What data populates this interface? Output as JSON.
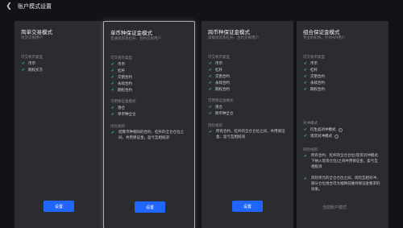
{
  "header": {
    "title": "账户模式设置"
  },
  "cards": [
    {
      "title": "简单交易模式",
      "subtitle": "现货交易用户",
      "tradable_label": "可交易币类型",
      "tradable": [
        "币币",
        "期权买方"
      ],
      "button": "设置"
    },
    {
      "title": "单币种保证金模式",
      "subtitle": "普通现货及杠杆、合约交易用户",
      "tradable_label": "可交易币类型",
      "tradable": [
        "币币",
        "杠杆",
        "交割合约",
        "永续合约",
        "期权合约"
      ],
      "margin_label": "可用保证金模式",
      "margin": [
        "逐仓",
        "单币种全仓"
      ],
      "risk_label": "风险规则",
      "risk_text": "结算币种相同的合约、杠杆的全仓仓位之间，共用保证金，盈亏互相抵消",
      "button": "设置"
    },
    {
      "title": "跨币种保证金模式",
      "subtitle": "高级现货及杠杆、合约交易用户",
      "tradable_label": "可交易币类型",
      "tradable": [
        "币币",
        "杠杆",
        "交割合约",
        "永续合约",
        "期权合约"
      ],
      "margin_label": "可用保证金模式",
      "margin": [
        "逐仓",
        "跨币种全仓"
      ],
      "risk_label": "风险规则",
      "risk_text": "所有合约、杠杆的全仓仓位之间，共用保证金，盈亏互相抵消",
      "button": "设置"
    },
    {
      "title": "组合保证金模式",
      "subtitle": "专业的机构、针对API用户",
      "tradable_label": "可交易币类型",
      "tradable": [
        "币币",
        "杠杆",
        "交割合约",
        "永续合约",
        "期权合约"
      ],
      "hedge_label": "对冲模式",
      "hedge": [
        "衍生品对冲模式",
        "现货对冲模式"
      ],
      "risk_label": "风险规则",
      "risk_items": [
        "所有合约、杠杆的全仓仓位(现货对冲模式下纳入现货仓位)之间共用保证金，盈亏互相抵消",
        "风险单元的全仓仓位之间，风险互相对冲，部分仓位组合可大幅降低维持保证金要求的效果。"
      ],
      "current_label": "当前账户模式"
    }
  ]
}
